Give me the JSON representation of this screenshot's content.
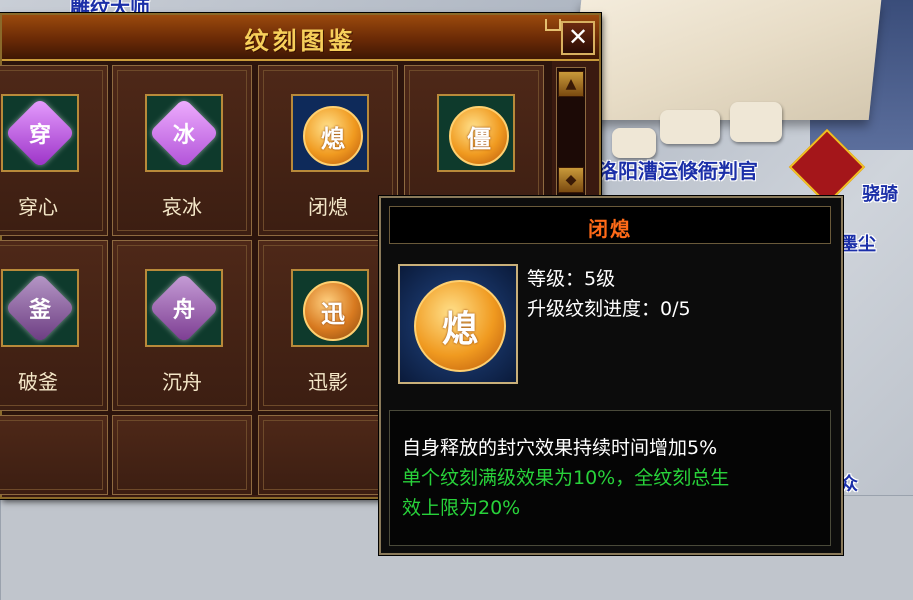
{
  "scene": {
    "npc_top_name": "雕纹大师",
    "npc_right_name": "洛阳漕运倏衙判官",
    "npc_fragment_1": "骁骑",
    "npc_fragment_2": "墨尘",
    "bottom_fragment": "众"
  },
  "codex": {
    "title": "纹刻图鉴",
    "close_label": "✕",
    "items": [
      {
        "label": "穿心",
        "glyph": "穿",
        "kind": "gem",
        "color": "#b052d6"
      },
      {
        "label": "哀冰",
        "glyph": "冰",
        "kind": "gem",
        "color": "#c060e0"
      },
      {
        "label": "闭熄",
        "glyph": "熄",
        "kind": "coin",
        "color": "#f09a20"
      },
      {
        "label": "",
        "glyph": "僵",
        "kind": "coin",
        "color": "#f09a20"
      },
      {
        "label": "破釜",
        "glyph": "釜",
        "kind": "gem",
        "color": "#7a4a8a"
      },
      {
        "label": "沉舟",
        "glyph": "舟",
        "kind": "gem",
        "color": "#8a4a9a"
      },
      {
        "label": "迅影",
        "glyph": "迅",
        "kind": "coin",
        "color": "#c87a20"
      }
    ]
  },
  "tooltip": {
    "title": "闭熄",
    "icon_glyph": "熄",
    "level": "等级：5级",
    "progress": "升级纹刻进度：0/5",
    "effect": "自身释放的封穴效果持续时间增加5%",
    "note_line1": "单个纹刻满级效果为10%，全纹刻总生",
    "note_line2": "效上限为20%"
  },
  "colors": {
    "title_gold": "#f6cf5a",
    "tooltip_title": "#ff6a18",
    "note_green": "#28d23a"
  }
}
